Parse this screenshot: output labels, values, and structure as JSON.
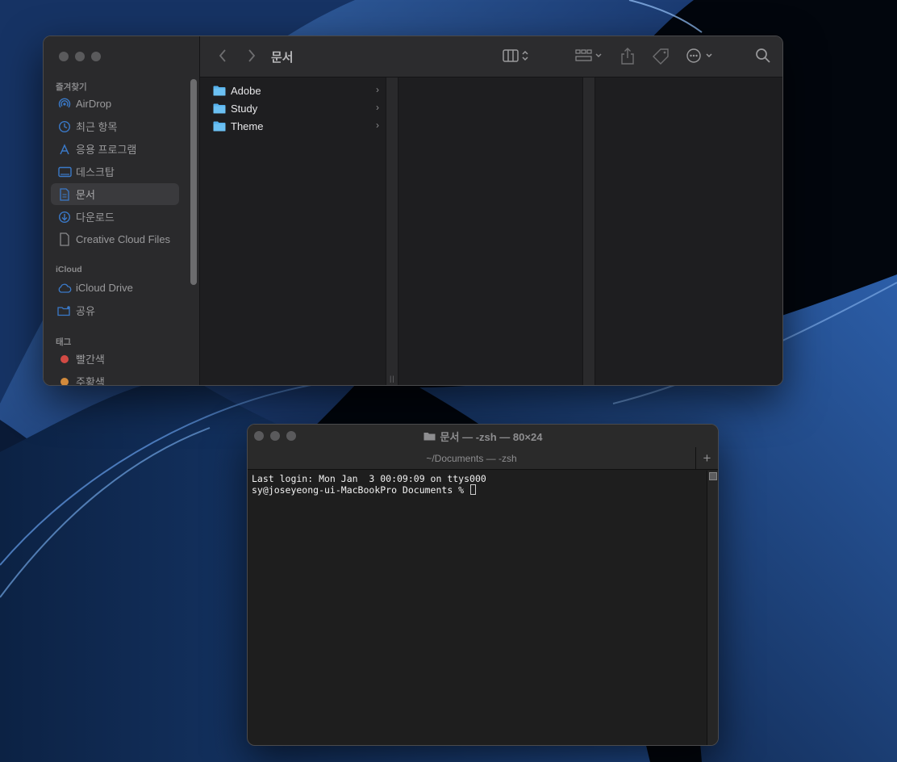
{
  "colors": {
    "folder_blue": "#56b1ec",
    "tag_red": "#d24a44",
    "tag_orange": "#d28a3c",
    "accent_blue": "#2f83ea"
  },
  "finder": {
    "title": "문서",
    "sidebar": {
      "favorites_header": "즐겨찾기",
      "favorites": [
        {
          "label": "AirDrop",
          "icon": "airdrop-icon"
        },
        {
          "label": "최근 항목",
          "icon": "clock-icon"
        },
        {
          "label": "응용 프로그램",
          "icon": "applications-icon"
        },
        {
          "label": "데스크탑",
          "icon": "desktop-icon"
        },
        {
          "label": "문서",
          "icon": "document-icon",
          "selected": true
        },
        {
          "label": "다운로드",
          "icon": "download-icon"
        },
        {
          "label": "Creative Cloud Files",
          "icon": "file-icon"
        }
      ],
      "icloud_header": "iCloud",
      "icloud": [
        {
          "label": "iCloud Drive",
          "icon": "cloud-icon"
        },
        {
          "label": "공유",
          "icon": "shared-folder-icon"
        }
      ],
      "tags_header": "태그",
      "tags": [
        {
          "label": "빨간색",
          "color": "#d24a44"
        },
        {
          "label": "주황색",
          "color": "#d28a3c"
        }
      ]
    },
    "files": [
      {
        "name": "Adobe"
      },
      {
        "name": "Study"
      },
      {
        "name": "Theme"
      }
    ]
  },
  "terminal": {
    "title": "문서 — -zsh — 80×24",
    "tab_label": "~/Documents — -zsh",
    "plus_label": "+",
    "lines": [
      "Last login: Mon Jan  3 00:09:09 on ttys000",
      "sy@joseyeong-ui-MacBookPro Documents % "
    ]
  }
}
